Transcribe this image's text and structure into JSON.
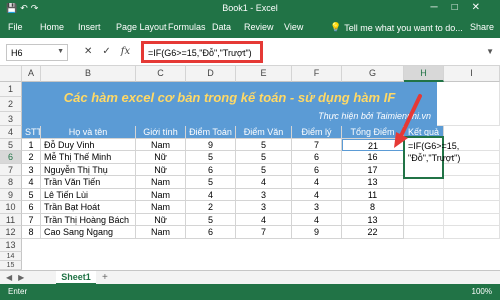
{
  "window": {
    "title": "Book1 - Excel"
  },
  "ribbon": {
    "tabs": [
      "File",
      "Home",
      "Insert",
      "Page Layout",
      "Formulas",
      "Data",
      "Review",
      "View"
    ],
    "tell_me": "Tell me what you want to do...",
    "share": "Share"
  },
  "formula_bar": {
    "name_box": "H6",
    "cancel_icon": "✕",
    "enter_icon": "✓",
    "fx_label": "fx",
    "formula": "=IF(G6>=15,\"Đỗ\",\"Trượt\")"
  },
  "columns": [
    "A",
    "B",
    "C",
    "D",
    "E",
    "F",
    "G",
    "H",
    "I"
  ],
  "rows": [
    "1",
    "2",
    "3",
    "4",
    "5",
    "6",
    "7",
    "8",
    "9",
    "10",
    "11",
    "12",
    "13",
    "14",
    "15"
  ],
  "banner": {
    "title": "Các hàm excel cơ bản trong kế toán - sử dụng hàm IF",
    "credit": "Thực hiện bởi Taimienphi.vn"
  },
  "table": {
    "headers": [
      "STT",
      "Họ và tên",
      "Giới tính",
      "Điểm Toán",
      "Điểm Văn",
      "Điểm lý",
      "Tổng Điểm",
      "Kết quả"
    ],
    "rows": [
      [
        "1",
        "Đỗ Duy Vinh",
        "Nam",
        "9",
        "5",
        "7",
        "21"
      ],
      [
        "2",
        "Mễ Thị Thế Minh",
        "Nữ",
        "5",
        "5",
        "6",
        "16"
      ],
      [
        "3",
        "Nguyễn Thị Thụ",
        "Nữ",
        "6",
        "5",
        "6",
        "17"
      ],
      [
        "4",
        "Trần Văn Tiến",
        "Nam",
        "5",
        "4",
        "4",
        "13"
      ],
      [
        "5",
        "Lê Tiến Lùi",
        "Nam",
        "4",
        "3",
        "4",
        "11"
      ],
      [
        "6",
        "Trần Bạt Hoát",
        "Nam",
        "2",
        "3",
        "3",
        "8"
      ],
      [
        "7",
        "Trần Thị Hoàng Bách",
        "Nữ",
        "5",
        "4",
        "4",
        "13"
      ],
      [
        "8",
        "Cao Sang Ngang",
        "Nam",
        "6",
        "7",
        "9",
        "22"
      ]
    ]
  },
  "active_cell": {
    "line1": "=IF(G6>=15,",
    "line2": "\"Đỗ\",\"Trượt\")"
  },
  "sheets": {
    "active": "Sheet1",
    "add": "+"
  },
  "status": {
    "mode": "Enter",
    "zoom": "100%"
  },
  "colors": {
    "excel_green": "#217346",
    "header_blue": "#5b9bd5",
    "banner_title": "#ffd966",
    "highlight_red": "#e53935"
  }
}
